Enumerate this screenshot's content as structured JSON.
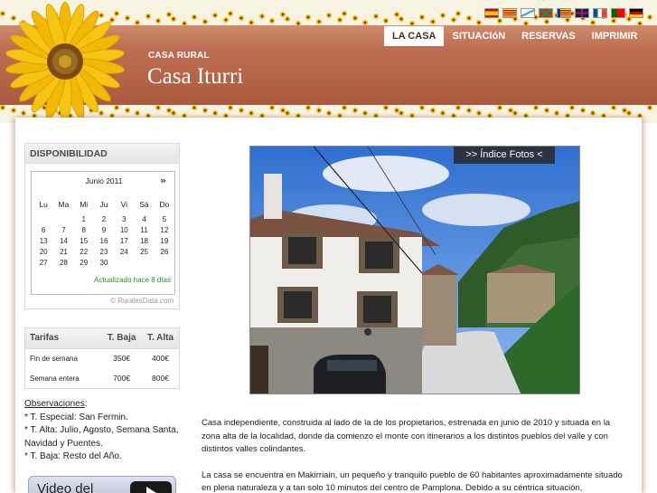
{
  "header": {
    "subtitle": "CASA RURAL",
    "title": "Casa Iturri"
  },
  "nav": {
    "items": [
      {
        "label": "LA CASA",
        "active": true
      },
      {
        "label": "SITUACIóN",
        "active": false
      },
      {
        "label": "RESERVAS",
        "active": false
      },
      {
        "label": "IMPRIMIR",
        "active": false
      }
    ]
  },
  "languages": [
    "spain-flag-icon",
    "catalonia-flag-icon",
    "galicia-flag-icon",
    "basque-flag-icon",
    "valencia-flag-icon",
    "uk-flag-icon",
    "france-flag-icon",
    "portugal-flag-icon",
    "germany-flag-icon"
  ],
  "availability": {
    "heading": "DISPONIBILIDAD",
    "month": "Junio 2011",
    "next": "»",
    "weekdays": [
      "Lu",
      "Ma",
      "Mi",
      "Ju",
      "Vi",
      "Sá",
      "Do"
    ],
    "weeks": [
      [
        "",
        "",
        "1",
        "2",
        "3",
        "4",
        "5"
      ],
      [
        "6",
        "7",
        "8",
        "9",
        "10",
        "11",
        "12"
      ],
      [
        "13",
        "14",
        "15",
        "16",
        "17",
        "18",
        "19"
      ],
      [
        "20",
        "21",
        "22",
        "23",
        "24",
        "25",
        "26"
      ],
      [
        "27",
        "28",
        "29",
        "30",
        "",
        "",
        ""
      ]
    ],
    "updated": "Actualizado hace 8 días",
    "credit": "© RuralesData.com"
  },
  "rates": {
    "headers": [
      "Tarifas",
      "T. Baja",
      "T. Alta"
    ],
    "rows": [
      [
        "Fin de semana",
        "350€",
        "400€"
      ],
      [
        "Semana entera",
        "700€",
        "800€"
      ]
    ]
  },
  "observations": {
    "title": "Observaciones",
    "lines": [
      "* T. Especial: San Fermin.",
      "* T. Alta: Julio, Agosto, Semana Santa, Navidad y Puentes.",
      "* T. Baja: Resto del Año."
    ]
  },
  "video": {
    "label": "Video del"
  },
  "photo": {
    "button": ">> Índice Fotos <"
  },
  "description": {
    "paragraphs": [
      "Casa independiente, construida al lado de la de los propietarios, estrenada en junio de 2010 y situada en la zona alta de la localidad, donde da comienzo el monte con itinerarios a los distintos pueblos del valle y con distintos valles colindantes.",
      "La casa se encuentra en Makirriain, un pequeño y tranquilo pueblo de 60 habitantes aproximadamente situado en plena naturaleza y a tan solo 10 minutos del centro de Pamplona. Debido a su céntrica situación,"
    ]
  },
  "colors": {
    "header_band": "#b9684c",
    "nav_active_bg": "#ffffff",
    "updated_text": "#2f8a2f"
  }
}
